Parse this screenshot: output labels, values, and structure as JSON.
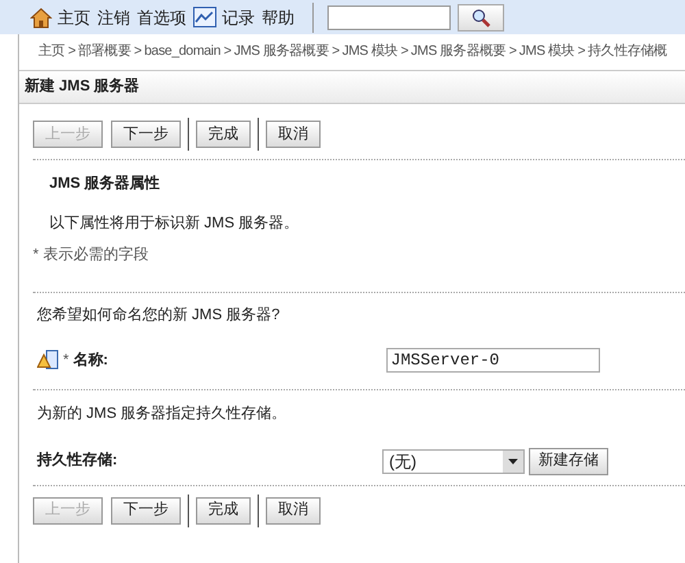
{
  "toolbar": {
    "links": [
      {
        "kind": "home",
        "label": "主页"
      },
      {
        "kind": "text",
        "label": "注销"
      },
      {
        "kind": "text",
        "label": "首选项"
      },
      {
        "kind": "chart",
        "label": "记录"
      },
      {
        "kind": "text",
        "label": "帮助"
      }
    ]
  },
  "breadcrumb": [
    "主页 >",
    "部署概要 >",
    "base_domain >",
    "JMS 服务器概要 >",
    "JMS 模块 >",
    "JMS 服务器概要 >",
    "JMS 模块 >",
    "持久性存储概"
  ],
  "panel": {
    "title": "新建 JMS 服务器",
    "top_buttons": [
      [
        {
          "label": "上一步",
          "disabled": true
        },
        {
          "label": "下一步",
          "disabled": false
        }
      ],
      [
        {
          "label": "完成",
          "disabled": false
        }
      ],
      [
        {
          "label": "取消",
          "disabled": false
        }
      ]
    ],
    "section_title": "JMS 服务器属性",
    "intro": "以下属性将用于标识新 JMS 服务器。",
    "required_note": "* 表示必需的字段",
    "name_question": "您希望如何命名您的新 JMS 服务器?",
    "name_field": {
      "required_mark": "*",
      "label": "名称:",
      "value": "JMSServer-0"
    },
    "store_question": "为新的 JMS 服务器指定持久性存储。",
    "store_field": {
      "label": "持久性存储:",
      "value": "(无)",
      "button": "新建存储"
    },
    "bottom_buttons": [
      [
        {
          "label": "上一步",
          "disabled": true
        },
        {
          "label": "下一步",
          "disabled": false
        }
      ],
      [
        {
          "label": "完成",
          "disabled": false
        }
      ],
      [
        {
          "label": "取消",
          "disabled": false
        }
      ]
    ]
  }
}
